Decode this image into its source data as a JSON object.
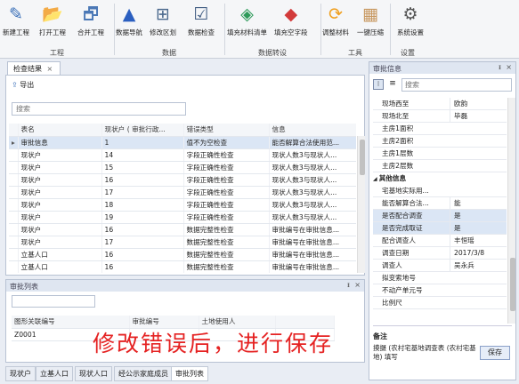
{
  "toolbar": {
    "buttons": [
      {
        "label": "新建工程",
        "icon": "new-project-icon",
        "glyph": "✎",
        "color": "#3a6fb8"
      },
      {
        "label": "打开工程",
        "icon": "open-project-icon",
        "glyph": "📂",
        "color": "#e0a32a"
      },
      {
        "label": "合并工程",
        "icon": "merge-project-icon",
        "glyph": "🗗",
        "color": "#4b78b6"
      },
      {
        "label": "数据导航",
        "icon": "navigation-icon",
        "glyph": "▲",
        "color": "#2b5fc0"
      },
      {
        "label": "修改区划",
        "icon": "edit-region-icon",
        "glyph": "⊞",
        "color": "#4c6a8e"
      },
      {
        "label": "数据检查",
        "icon": "data-check-icon",
        "glyph": "☑",
        "color": "#3d5a80"
      },
      {
        "label": "填充材料清单",
        "icon": "fill-material-icon",
        "glyph": "◈",
        "color": "#2e9a5a"
      },
      {
        "label": "填充空字段",
        "icon": "fill-empty-field-icon",
        "glyph": "◆",
        "color": "#d23a3a"
      },
      {
        "label": "调整材料",
        "icon": "adjust-material-icon",
        "glyph": "⟳",
        "color": "#f0a020"
      },
      {
        "label": "一键压缩",
        "icon": "compress-icon",
        "glyph": "▦",
        "color": "#c89860"
      },
      {
        "label": "系统设置",
        "icon": "settings-icon",
        "glyph": "⚙",
        "color": "#555555"
      }
    ],
    "groups": [
      "工程",
      "数据",
      "数据转设",
      "工具",
      "设置"
    ]
  },
  "check_results": {
    "tab_label": "检查结果",
    "export_label": "导出",
    "search_placeholder": "搜索",
    "columns": [
      "表名",
      "现状户 ( 审批行政...",
      "错误类型",
      "信息"
    ],
    "rows": [
      {
        "table": "审批信息",
        "household": "1",
        "type": "值不为空检查",
        "info": "能否解算合法使用范..."
      },
      {
        "table": "现状户",
        "household": "14",
        "type": "字段正确性检查",
        "info": "现状人数3与现状人..."
      },
      {
        "table": "现状户",
        "household": "15",
        "type": "字段正确性检查",
        "info": "现状人数3与现状人..."
      },
      {
        "table": "现状户",
        "household": "16",
        "type": "字段正确性检查",
        "info": "现状人数3与现状人..."
      },
      {
        "table": "现状户",
        "household": "17",
        "type": "字段正确性检查",
        "info": "现状人数3与现状人..."
      },
      {
        "table": "现状户",
        "household": "18",
        "type": "字段正确性检查",
        "info": "现状人数3与现状人..."
      },
      {
        "table": "现状户",
        "household": "19",
        "type": "字段正确性检查",
        "info": "现状人数3与现状人..."
      },
      {
        "table": "现状户",
        "household": "16",
        "type": "数据完整性检查",
        "info": "审批编号在审批信息..."
      },
      {
        "table": "现状户",
        "household": "17",
        "type": "数据完整性检查",
        "info": "审批编号在审批信息..."
      },
      {
        "table": "立基人口",
        "household": "16",
        "type": "数据完整性检查",
        "info": "审批编号在审批信息..."
      },
      {
        "table": "立基人口",
        "household": "16",
        "type": "数据完整性检查",
        "info": "审批编号在审批信息..."
      }
    ]
  },
  "approval_list": {
    "tab_label": "审批列表",
    "columns": [
      "图形关联编号",
      "审批编号",
      "土地使用人",
      ""
    ],
    "rows": [
      {
        "id": "Z0001"
      }
    ]
  },
  "bottom_tabs": [
    "现状户",
    "立基人口",
    "现状人口",
    "经公示家庭成员",
    "审批列表"
  ],
  "overlay_caption": "修改错误后，进行保存",
  "approval_info": {
    "title": "审批信息",
    "search_placeholder": "搜索",
    "rows": [
      {
        "key": "现场西至",
        "value": "欧韵"
      },
      {
        "key": "现场北至",
        "value": "毕磊"
      },
      {
        "key": "主房1面积",
        "value": ""
      },
      {
        "key": "主房2面积",
        "value": ""
      },
      {
        "key": "主房1层数",
        "value": ""
      },
      {
        "key": "主房2层数",
        "value": ""
      }
    ],
    "section": "其他信息",
    "other_rows": [
      {
        "key": "宅基地实际用...",
        "value": ""
      },
      {
        "key": "能否解算合法...",
        "value": "能"
      },
      {
        "key": "是否配合调查",
        "value": "是"
      },
      {
        "key": "是否完成取证",
        "value": "是"
      },
      {
        "key": "配合调查人",
        "value": "丰恒瑶"
      },
      {
        "key": "调查日期",
        "value": "2017/3/8"
      },
      {
        "key": "调查人",
        "value": "吴永兵"
      },
      {
        "key": "拟变索地号",
        "value": ""
      },
      {
        "key": "不动产单元号",
        "value": ""
      },
      {
        "key": "比例尺",
        "value": ""
      }
    ],
    "desc_title": "备注",
    "desc_text": "摸摄 (农村宅基地调查表 (农村宅基地) 填写",
    "save_label": "保存"
  }
}
